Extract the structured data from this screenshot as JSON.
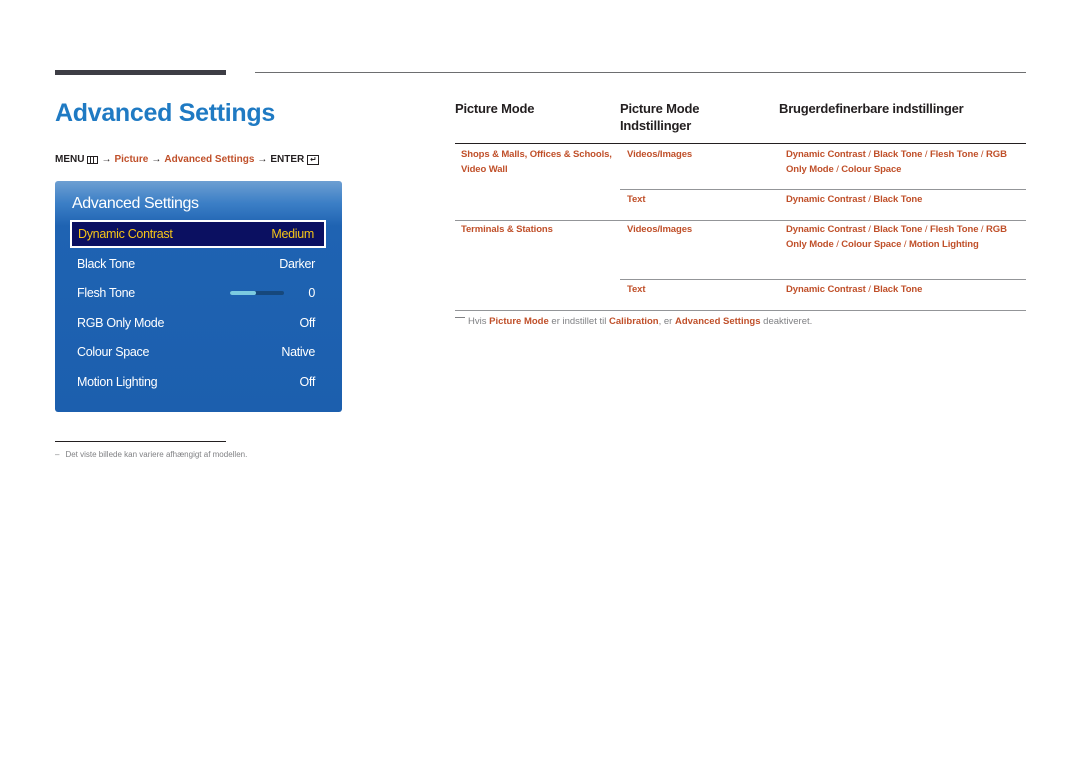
{
  "page": {
    "title": "Advanced Settings"
  },
  "breadcrumb": {
    "menu": "MENU",
    "menu_icon": "menu-grid-icon",
    "arrow": "→",
    "picture": "Picture",
    "advanced": "Advanced Settings",
    "enter": "ENTER",
    "enter_icon": "enter-icon"
  },
  "osd": {
    "title": "Advanced Settings",
    "items": [
      {
        "label": "Dynamic Contrast",
        "value": "Medium",
        "selected": true
      },
      {
        "label": "Black Tone",
        "value": "Darker"
      },
      {
        "label": "Flesh Tone",
        "value": "0",
        "slider_fraction": 0.48
      },
      {
        "label": "RGB Only Mode",
        "value": "Off"
      },
      {
        "label": "Colour Space",
        "value": "Native"
      },
      {
        "label": "Motion Lighting",
        "value": "Off"
      }
    ]
  },
  "footnote": {
    "dash": "–",
    "text": "Det viste billede kan variere afhængigt af modellen."
  },
  "table": {
    "headers": [
      "Picture Mode",
      "Picture Mode Indstillinger",
      "Brugerdefinerbare indstillinger"
    ],
    "header_lines": {
      "col2_line1": "Picture Mode",
      "col2_line2": "Indstillinger"
    },
    "rows": [
      {
        "mode_line1": "Shops & Malls, Offices & Schools,",
        "mode_line2": "Video Wall",
        "setting": "Videos/Images",
        "options": [
          "Dynamic Contrast",
          "Black Tone",
          "Flesh Tone",
          "RGB Only Mode",
          "Colour Space"
        ]
      },
      {
        "mode_line1": "",
        "setting": "Text",
        "options": [
          "Dynamic Contrast",
          "Black Tone"
        ]
      },
      {
        "mode_line1": "Terminals & Stations",
        "setting": "Videos/Images",
        "options": [
          "Dynamic Contrast",
          "Black Tone",
          "Flesh Tone",
          "RGB Only Mode",
          "Colour Space",
          "Motion Lighting"
        ]
      },
      {
        "mode_line1": "",
        "setting": "Text",
        "options": [
          "Dynamic Contrast",
          "Black Tone"
        ]
      }
    ],
    "separator": "/"
  },
  "note": {
    "part1": "Hvis",
    "hl1": "Picture Mode",
    "part2": "er indstillet til",
    "hl2": "Calibration",
    "part3": ", er",
    "hl3": "Advanced Settings",
    "part4": "deaktiveret."
  },
  "colors": {
    "title_blue": "#1f7ac3",
    "accent_orange": "#c0502a",
    "osd_blue": "#1c5fae",
    "osd_selected_bg": "#0b1061",
    "osd_selected_text": "#f5c518"
  }
}
